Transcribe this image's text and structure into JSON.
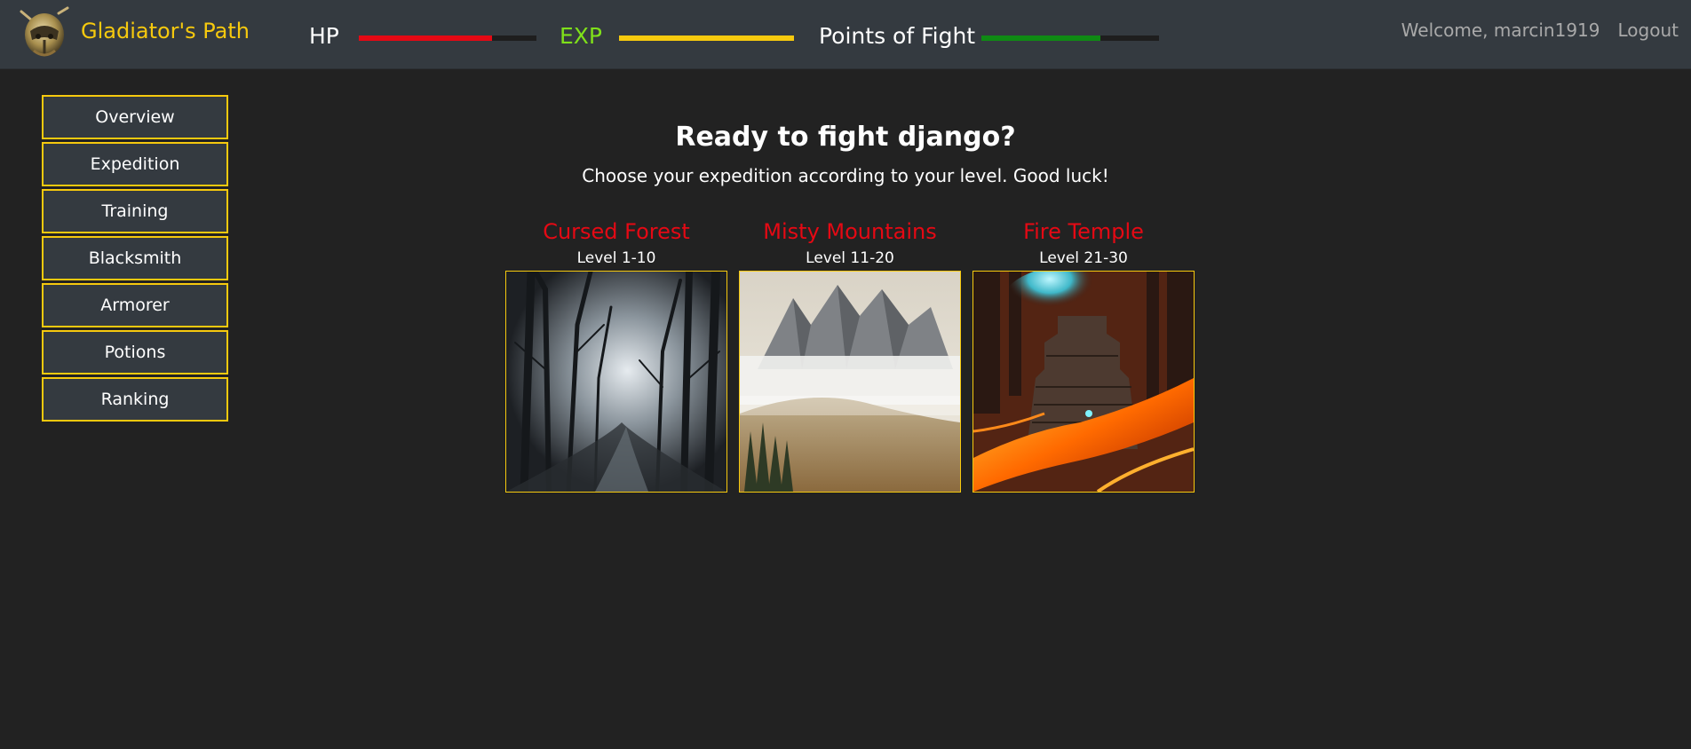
{
  "app": {
    "brand": "Gladiator's Path"
  },
  "stats": [
    {
      "label": "HP",
      "label_color": "#ffffff",
      "bar_color": "#e50914",
      "fill": 0.75
    },
    {
      "label": "EXP",
      "label_color": "#7fe01a",
      "bar_color": "#f6c90e",
      "fill": 1.0
    },
    {
      "label": "Points of Fight",
      "label_color": "#ffffff",
      "bar_color": "#0f8a14",
      "fill": 0.67
    }
  ],
  "user": {
    "welcome": "Welcome, marcin1919",
    "logout": "Logout"
  },
  "sidebar": {
    "items": [
      {
        "label": "Overview"
      },
      {
        "label": "Expedition"
      },
      {
        "label": "Training"
      },
      {
        "label": "Blacksmith"
      },
      {
        "label": "Armorer"
      },
      {
        "label": "Potions"
      },
      {
        "label": "Ranking"
      }
    ]
  },
  "main": {
    "title": "Ready to fight django?",
    "subtitle": "Choose your expedition according to your level. Good luck!"
  },
  "expeditions": [
    {
      "name": "Cursed Forest",
      "level": "Level 1-10",
      "image": "foggy-dark-forest"
    },
    {
      "name": "Misty Mountains",
      "level": "Level 11-20",
      "image": "misty-mountain-peaks"
    },
    {
      "name": "Fire Temple",
      "level": "Level 21-30",
      "image": "temple-in-lava"
    }
  ],
  "colors": {
    "background": "#222222",
    "navbar": "#343a40",
    "accent_gold": "#f6c90e",
    "expedition_red": "#e50914"
  }
}
